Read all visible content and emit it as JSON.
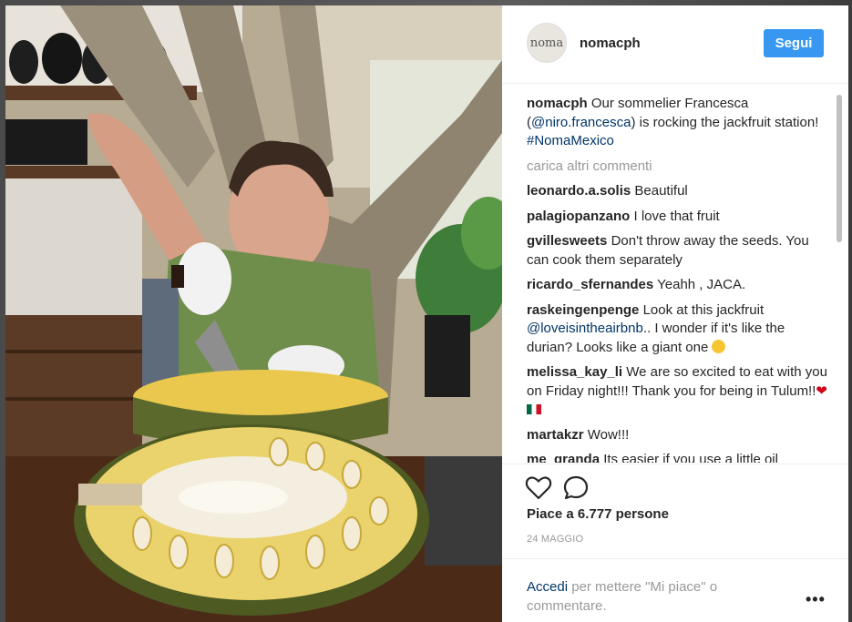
{
  "post": {
    "username": "nomacph",
    "avatar_text": "noma",
    "follow_label": "Segui",
    "caption": {
      "username": "nomacph",
      "text_before": "Our sommelier Francesca (",
      "mention": "@niro.francesca",
      "text_after": ") is rocking the jackfruit station!",
      "hashtag": "#NomaMexico"
    },
    "load_more": "carica altri commenti",
    "comments": [
      {
        "username": "leonardo.a.solis",
        "text": "Beautiful"
      },
      {
        "username": "palagiopanzano",
        "text": "I love that fruit"
      },
      {
        "username": "gvillesweets",
        "text": "Don't throw away the seeds. You can cook them separately"
      },
      {
        "username": "ricardo_sfernandes",
        "text": "Yeahh , JACA."
      },
      {
        "username": "raskeingenpenge",
        "text_before": "Look at this jackfruit",
        "mention": "@loveisintheairbnb",
        "text_after": ".. I wonder if it's like the durian? Looks like a giant one"
      },
      {
        "username": "melissa_kay_li",
        "text": "We are so excited to eat with you on Friday night!!! Thank you for being in Tulum!!"
      },
      {
        "username": "martakzr",
        "text": "Wow!!!"
      },
      {
        "username": "me_granda",
        "text": "Its easier if you use a little oil"
      }
    ],
    "likes": "Piace a 6.777 persone",
    "date": "24 MAGGIO",
    "login": {
      "link": "Accedi",
      "text": "per mettere \"Mi piace\" o commentare."
    },
    "more_label": "•••",
    "icons": [
      "heart-icon",
      "comment-icon",
      "more-options-icon"
    ],
    "colors": {
      "accent": "#3897f0",
      "link": "#003569",
      "muted": "#999999",
      "text": "#262626"
    }
  }
}
